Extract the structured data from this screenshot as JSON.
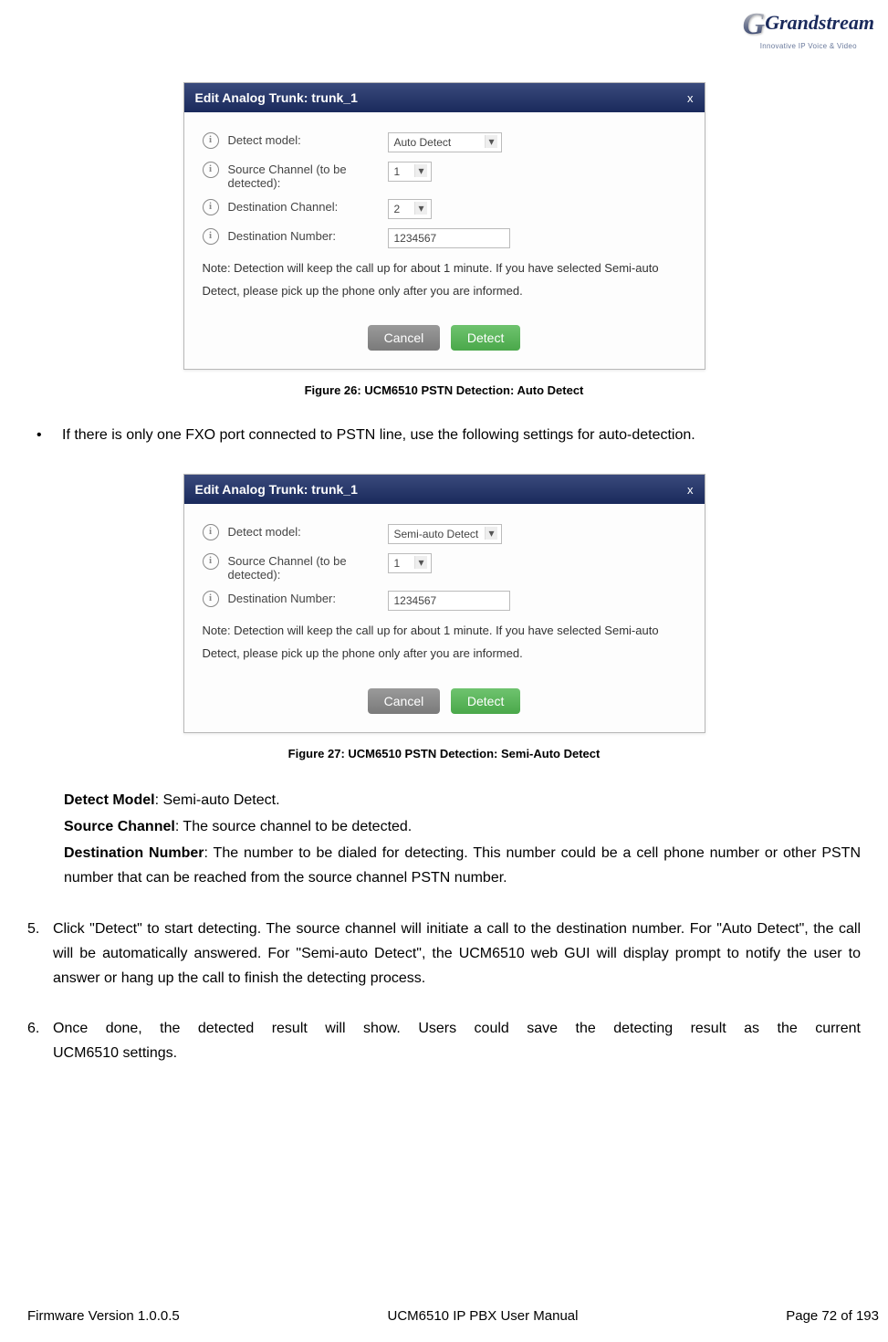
{
  "logo": {
    "main": "Grandstream",
    "sub": "Innovative IP Voice & Video"
  },
  "dialog1": {
    "title": "Edit Analog Trunk: trunk_1",
    "close": "x",
    "fields": {
      "detect_model_label": "Detect model:",
      "detect_model_value": "Auto Detect",
      "source_channel_label": "Source Channel (to be detected):",
      "source_channel_value": "1",
      "dest_channel_label": "Destination Channel:",
      "dest_channel_value": "2",
      "dest_number_label": "Destination Number:",
      "dest_number_value": "1234567"
    },
    "note": "Note: Detection will keep the call up for about 1 minute. If you have selected Semi-auto Detect, please pick up the phone only after you are informed.",
    "cancel": "Cancel",
    "detect": "Detect"
  },
  "caption1": "Figure 26: UCM6510 PSTN Detection: Auto Detect",
  "bullet1": "If there is only one FXO port connected to PSTN line, use the following settings for auto-detection.",
  "dialog2": {
    "title": "Edit Analog Trunk: trunk_1",
    "close": "x",
    "fields": {
      "detect_model_label": "Detect model:",
      "detect_model_value": "Semi-auto Detect",
      "source_channel_label": "Source Channel (to be detected):",
      "source_channel_value": "1",
      "dest_number_label": "Destination Number:",
      "dest_number_value": "1234567"
    },
    "note": "Note: Detection will keep the call up for about 1 minute. If you have selected Semi-auto Detect, please pick up the phone only after you are informed.",
    "cancel": "Cancel",
    "detect": "Detect"
  },
  "caption2": "Figure 27: UCM6510 PSTN Detection: Semi-Auto Detect",
  "definitions": {
    "l1b": "Detect Model",
    "l1": ": Semi-auto Detect.",
    "l2b": "Source Channel",
    "l2": ": The source channel to be detected.",
    "l3b": "Destination Number",
    "l3": ": The number to be dialed for detecting. This number could be a cell phone number or other PSTN number that can be reached from the source channel PSTN number."
  },
  "step5num": "5.",
  "step5": "Click \"Detect\" to start detecting. The source channel will initiate a call to the destination number. For \"Auto Detect\", the call will be automatically answered. For \"Semi-auto Detect\", the UCM6510 web GUI will display prompt to notify the user to answer or hang up the call to finish the detecting process.",
  "step6num": "6.",
  "step6": "Once done, the detected result will show. Users could save the detecting result as the current UCM6510 settings.",
  "footer": {
    "left": "Firmware Version 1.0.0.5",
    "center": "UCM6510 IP PBX User Manual",
    "right": "Page 72 of 193"
  }
}
